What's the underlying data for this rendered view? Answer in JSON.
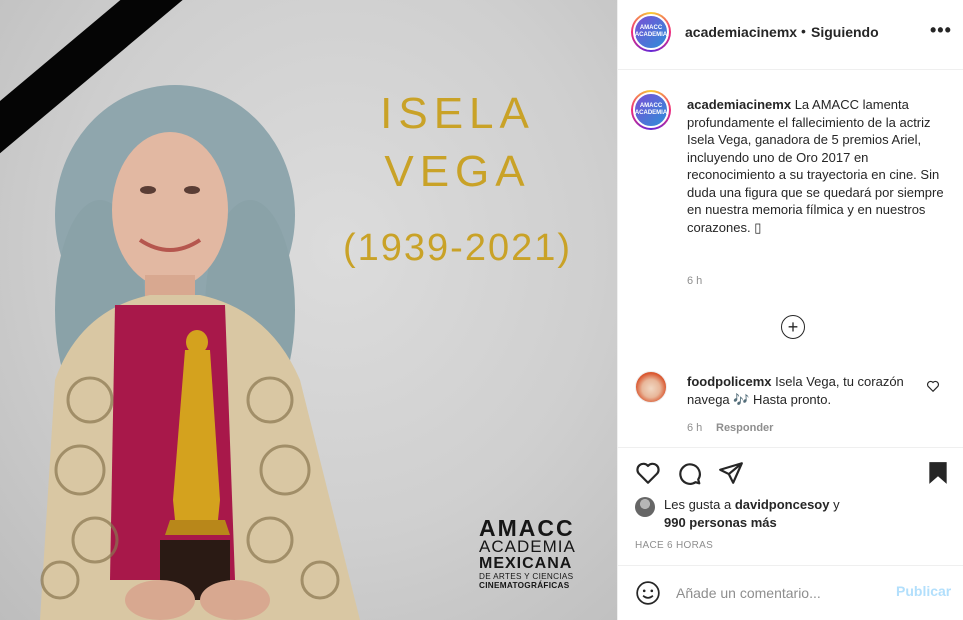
{
  "post_image": {
    "title_first": "ISELA",
    "title_last": "VEGA",
    "years": "(1939-2021)",
    "logo": {
      "acronym": "AMACC",
      "line1": "ACADEMIA",
      "line2": "MEXICANA",
      "line3": "DE ARTES Y CIENCIAS",
      "line4": "CINEMATOGRÁFICAS"
    },
    "title_color": "#c9a227"
  },
  "header": {
    "username": "academiacinemx",
    "separator": "•",
    "follow_status": "Siguiendo",
    "more": "•••",
    "avatar_text_1": "AMACC",
    "avatar_text_2": "ACADEMIA"
  },
  "caption": {
    "username": "academiacinemx",
    "text": "La AMACC lamenta profundamente el fallecimiento de la actriz Isela Vega, ganadora de 5 premios Ariel, incluyendo uno de Oro 2017 en reconocimiento a su trayectoria en cine. Sin duda una figura que se quedará por siempre en nuestra memoria fílmica y en nuestros corazones. ▯",
    "time": "6 h",
    "load_more": "+"
  },
  "comment": {
    "username": "foodpolicemx",
    "text": "Isela Vega, tu corazón navega 🎶 Hasta pronto.",
    "time": "6 h",
    "reply": "Responder"
  },
  "likes": {
    "prefix": "Les gusta a",
    "user": "davidponcesoy",
    "connector": "y",
    "count": "990 personas más"
  },
  "post_age": "HACE 6 HORAS",
  "comment_box": {
    "placeholder": "Añade un comentario...",
    "publish": "Publicar"
  },
  "colors": {
    "accent_blue": "#0095f6",
    "publish_disabled": "#b2dffc",
    "muted": "#8e8e8e"
  },
  "icons": [
    "heart-icon",
    "comment-icon",
    "share-icon",
    "bookmark-icon",
    "emoji-icon",
    "more-icon",
    "plus-circle-icon"
  ]
}
